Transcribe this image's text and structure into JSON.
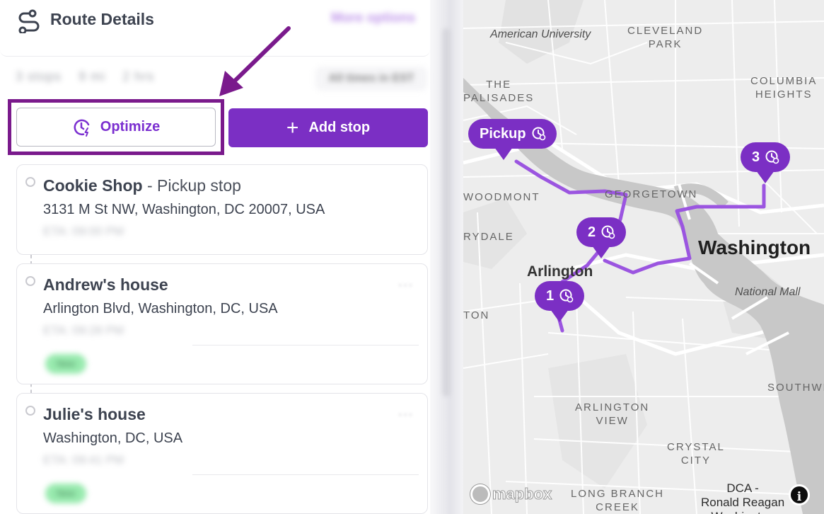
{
  "header": {
    "title": "Route Details",
    "more_options": "More options"
  },
  "summary": {
    "stops": "3 stops",
    "distance": "9 mi",
    "duration": "2 hrs",
    "timezone": "All times in EST"
  },
  "actions": {
    "optimize_label": "Optimize",
    "add_stop_label": "Add stop"
  },
  "stops": [
    {
      "name": "Cookie Shop",
      "type": " - Pickup stop",
      "address": "3131 M St NW, Washington, DC 20007, USA",
      "eta": "ETA: 09:00 PM"
    },
    {
      "name": "Andrew's house",
      "address": "Arlington Blvd, Washington, DC, USA",
      "eta": "ETA: 09:28 PM",
      "status": "New",
      "menu": "···"
    },
    {
      "name": "Julie's house",
      "address": "Washington, DC, USA",
      "eta": "ETA: 09:41 PM",
      "status": "New",
      "menu": "···"
    }
  ],
  "map": {
    "labels": {
      "american_university": "American University",
      "cleveland_park": "CLEVELAND\nPARK",
      "the_palisades": "THE\nPALISADES",
      "columbia_heights": "COLUMBIA\nHEIGHTS",
      "woodmont": "WOODMONT",
      "georgetown": "GEORGETOWN",
      "rydale": "RYDALE",
      "washington": "Washington",
      "arlington": "Arlington",
      "national_mall": "National Mall",
      "ton": "TON",
      "southwest": "SOUTHWE",
      "arlington_view": "ARLINGTON\nVIEW",
      "crystal_city": "CRYSTAL\nCITY",
      "long_branch_creek": "LONG BRANCH\nCREEK",
      "dca": "DCA -\nRonald Reagan\nWashington"
    },
    "pins": {
      "pickup": "Pickup",
      "stop1": "1",
      "stop2": "2",
      "stop3": "3"
    },
    "attribution": "mapbox",
    "info": "i",
    "route_color": "#9b55e0"
  },
  "colors": {
    "accent": "#7b2fc4",
    "highlight_frame": "#7a1a8c"
  }
}
